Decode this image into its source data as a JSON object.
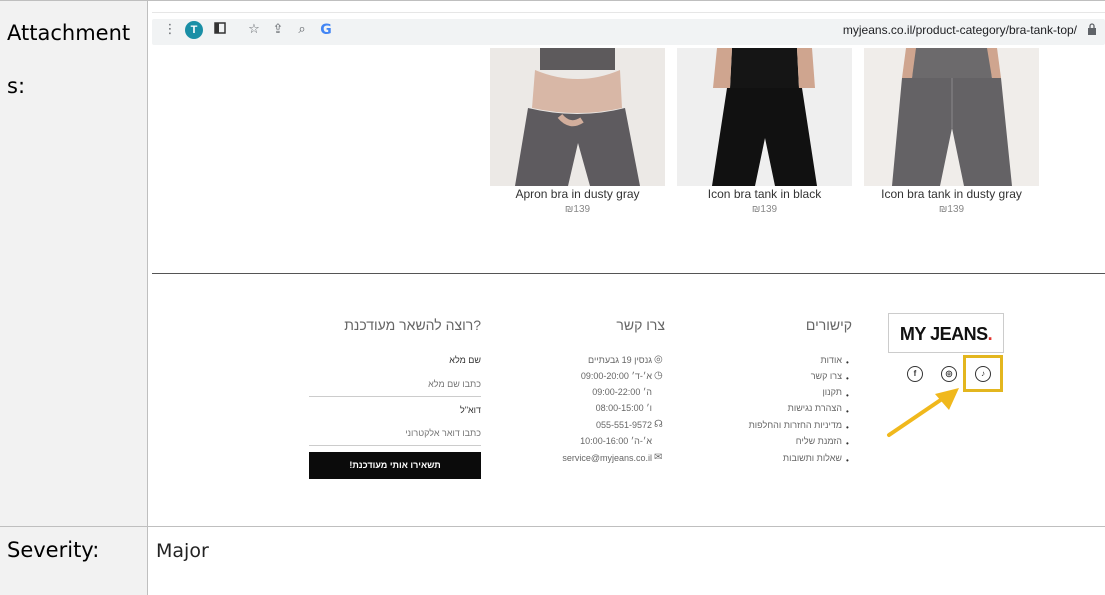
{
  "doc": {
    "attachments_label_1": "Attachment",
    "attachments_label_2": "s:",
    "severity_label": "Severity:",
    "severity_value": "Major"
  },
  "browser": {
    "avatar_letter": "T",
    "url": "myjeans.co.il/product-category/bra-tank-top/",
    "icons": [
      "more-vert-icon",
      "sidepanel-icon",
      "star-icon",
      "share-icon",
      "search-icon",
      "google-icon",
      "lock-icon"
    ]
  },
  "products": [
    {
      "name": "Apron bra in dusty gray",
      "price": "₪139"
    },
    {
      "name": "Icon bra tank in black",
      "price": "₪139"
    },
    {
      "name": "Icon bra tank in dusty gray",
      "price": "₪139"
    }
  ],
  "footer": {
    "newsletter": {
      "title": "רוצה להשאר מעודכנת?",
      "name_label": "שם מלא",
      "name_placeholder": "כתבו שם מלא",
      "email_label": "דוא\"ל",
      "email_placeholder": "כתבו דואר אלקטרוני",
      "button": "תשאירו אותי מעודכנת!"
    },
    "contact": {
      "title": "צרו קשר",
      "address": "גנסין 19 גבעתיים",
      "hours_1": "א׳-ד׳ 09:00-20:00",
      "hours_2": "ה׳ 09:00-22:00",
      "hours_3": "ו׳ 08:00-15:00",
      "phone": "055-551-9572",
      "phone_hours": "א׳-ה׳ 10:00-16:00",
      "email": "service@myjeans.co.il"
    },
    "links": {
      "title": "קישורים",
      "items": [
        "אודות",
        "צרו קשר",
        "תקנון",
        "הצהרת נגישות",
        "מדיניות החזרות והחלפות",
        "הזמנת שליח",
        "שאלות ותשובות"
      ]
    },
    "logo": {
      "text": "MY JEANS",
      "dot": "."
    },
    "social": [
      "facebook-icon",
      "instagram-icon",
      "tiktok-icon"
    ]
  },
  "colors": {
    "highlight": "#e3b61f",
    "arrow": "#f0b81c",
    "logo_dot": "#e3342f",
    "avatar": "#1a8fa6"
  }
}
